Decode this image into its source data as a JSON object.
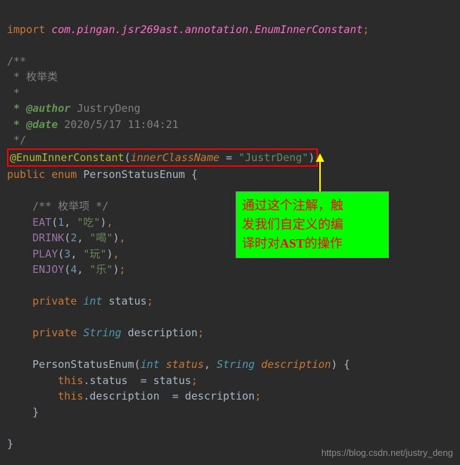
{
  "import": {
    "keyword": "import",
    "package": "com.pingan.jsr269ast.annotation.EnumInnerConstant"
  },
  "javadoc": {
    "open": "/**",
    "line1": " * 枚举类",
    "line2": " *",
    "author_tag": " * @author",
    "author_val": " JustryDeng",
    "date_tag": " * @date",
    "date_val": " 2020/5/17 11:04:21",
    "close": " */"
  },
  "annotation": {
    "name": "@EnumInnerConstant",
    "param": "innerClassName",
    "eq": " = ",
    "value": "\"JustrDeng\""
  },
  "decl": {
    "public": "public",
    "enum": "enum",
    "name": "PersonStatusEnum",
    "brace": " {"
  },
  "inner_comment": "/** 枚举项 */",
  "constants": [
    {
      "name": "EAT",
      "num": "1",
      "str": "\"吃\"",
      "sep": ","
    },
    {
      "name": "DRINK",
      "num": "2",
      "str": "\"喝\"",
      "sep": ","
    },
    {
      "name": "PLAY",
      "num": "3",
      "str": "\"玩\"",
      "sep": ","
    },
    {
      "name": "ENJOY",
      "num": "4",
      "str": "\"乐\"",
      "sep": ";"
    }
  ],
  "fields": {
    "private": "private",
    "int": "int",
    "status": "status",
    "string": "String",
    "description": "description"
  },
  "ctor": {
    "name": "PersonStatusEnum",
    "p1_type": "int",
    "p1_name": "status",
    "p2_type": "String",
    "p2_name": "description",
    "this": "this",
    "brace_open": ") {",
    "brace_close": "}"
  },
  "close_brace": "}",
  "callout": {
    "l1a": "通过这个注解，触",
    "l2a": "发我们自定义的编",
    "l3a": "译时对",
    "l3b": "AST",
    "l3c": "的操作"
  },
  "watermark": "https://blog.csdn.net/justry_deng"
}
